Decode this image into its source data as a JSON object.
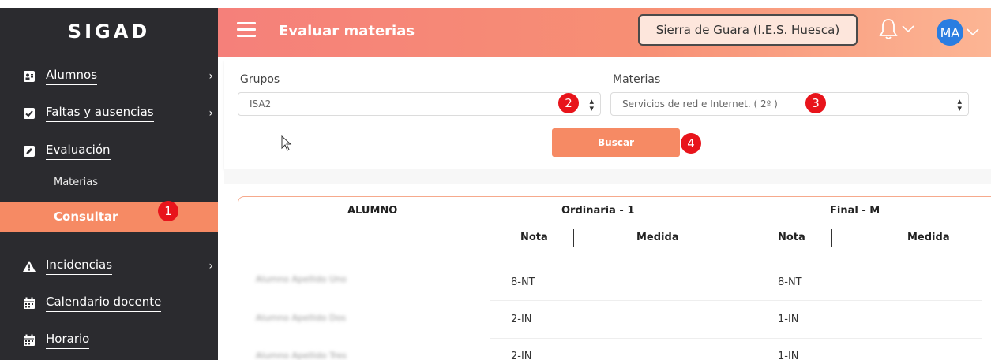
{
  "sidebar": {
    "brand": "SIGAD",
    "items": [
      {
        "label": "Alumnos",
        "icon": "id-card-icon",
        "has_children": true
      },
      {
        "label": "Faltas y ausencias",
        "icon": "check-square-icon",
        "has_children": true
      },
      {
        "label": "Evaluación",
        "icon": "pencil-square-icon",
        "has_children": false
      },
      {
        "label": "Incidencias",
        "icon": "warning-icon",
        "has_children": true
      },
      {
        "label": "Calendario docente",
        "icon": "calendar-icon",
        "has_children": false
      },
      {
        "label": "Horario",
        "icon": "calendar-icon",
        "has_children": false
      }
    ],
    "submenu": {
      "materias": "Materias",
      "consultar": "Consultar"
    }
  },
  "header": {
    "title": "Evaluar materias",
    "school": "Sierra de Guara (I.E.S. Huesca)",
    "avatar_initials": "MA"
  },
  "filters": {
    "grupos_label": "Grupos",
    "grupos_value": "ISA2",
    "materias_label": "Materias",
    "materias_value": "Servicios de red e Internet. ( 2º )",
    "search_label": "Buscar"
  },
  "markers": [
    "1",
    "2",
    "3",
    "4"
  ],
  "table": {
    "col_alumno": "ALUMNO",
    "group1": "Ordinaria - 1",
    "group2": "Final - M",
    "sub_nota": "Nota",
    "sub_medida": "Medida",
    "rows": [
      {
        "name": "Alumno Apellido Uno",
        "ordinaria_nota": "8-NT",
        "final_nota": "8-NT"
      },
      {
        "name": "Alumno Apellido Dos",
        "ordinaria_nota": "2-IN",
        "final_nota": "1-IN"
      },
      {
        "name": "Alumno Apellido Tres",
        "ordinaria_nota": "2-IN",
        "final_nota": "1-IN"
      }
    ]
  },
  "colors": {
    "sidebar_bg": "#2b2b2f",
    "accent": "#f68a64",
    "marker": "#e8141b",
    "avatar": "#2a7de1"
  }
}
